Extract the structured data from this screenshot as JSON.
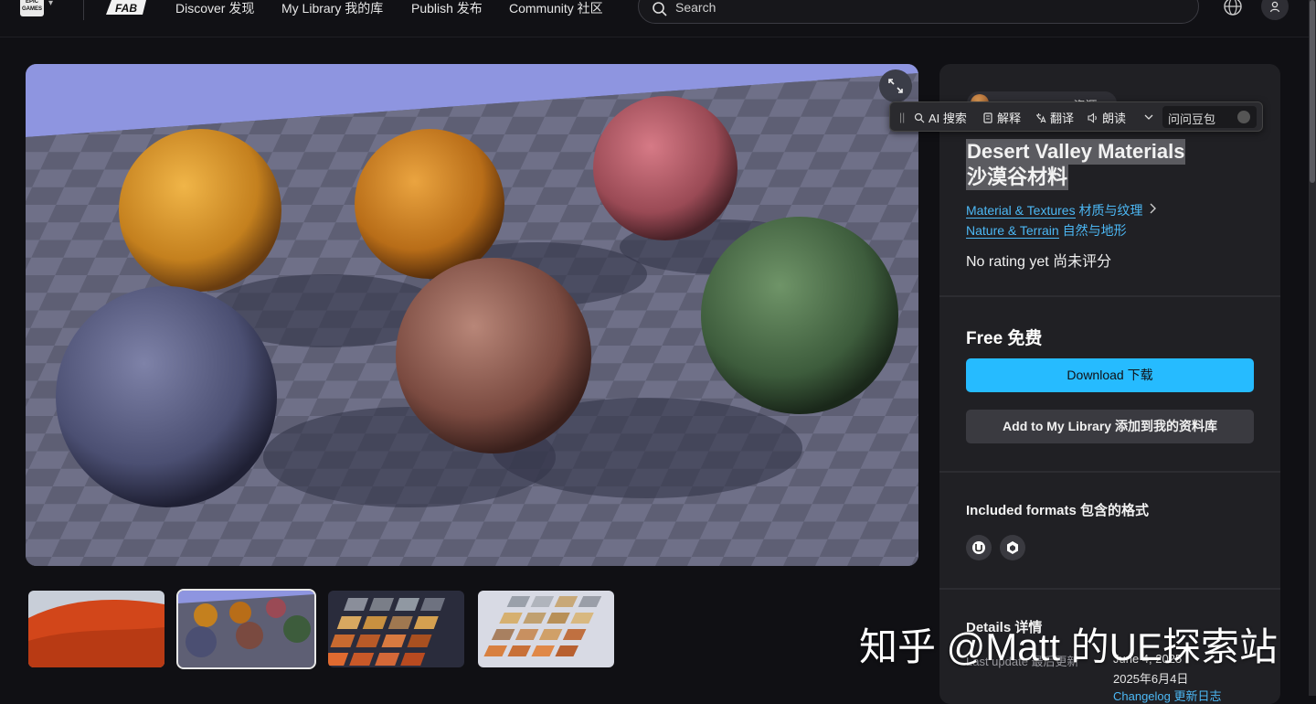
{
  "nav": {
    "epic_logo_text": "EPIC GAMES",
    "fab_logo_text": "FAB",
    "links": [
      {
        "label": "Discover 发现"
      },
      {
        "label": "My Library 我的库"
      },
      {
        "label": "Publish 发布"
      },
      {
        "label": "Community 社区"
      }
    ],
    "search_placeholder": "Search"
  },
  "gallery": {
    "thumbnails": [
      {
        "name": "red-terrain"
      },
      {
        "name": "material-spheres",
        "selected": true
      },
      {
        "name": "material-tiles-warm"
      },
      {
        "name": "material-tiles-light"
      }
    ]
  },
  "product": {
    "publisher": "DG Assets DG资源",
    "title_en": "Desert Valley Materials",
    "title_cn": "沙漠谷材料",
    "categories": [
      {
        "label_en": "Material & Textures",
        "label_cn": "材质与纹理"
      },
      {
        "label_en": "Nature & Terrain",
        "label_cn": "自然与地形"
      }
    ],
    "rating": "No rating yet 尚未评分",
    "price": "Free 免费",
    "download_label": "Download 下载",
    "add_library_label": "Add to My Library 添加到我的资料库",
    "formats_heading": "Included formats 包含的格式",
    "formats": [
      "unreal-engine-icon",
      "unity-icon"
    ],
    "details_heading": "Details 详情",
    "last_update_label": "Last update 最后更新",
    "last_update_en": "June 4, 2025",
    "last_update_cn": "2025年6月4日",
    "changelog_label": "Changelog 更新日志"
  },
  "ai_toolbar": {
    "search_label": "AI 搜索",
    "explain_label": "解释",
    "translate_label": "翻译",
    "read_label": "朗读",
    "input_placeholder": "问问豆包"
  },
  "watermark": "知乎 @Matt 的UE探索站",
  "colors": {
    "accent": "#26bbff",
    "link": "#4cb8f5",
    "panel_bg": "#202024",
    "page_bg": "#101014"
  }
}
